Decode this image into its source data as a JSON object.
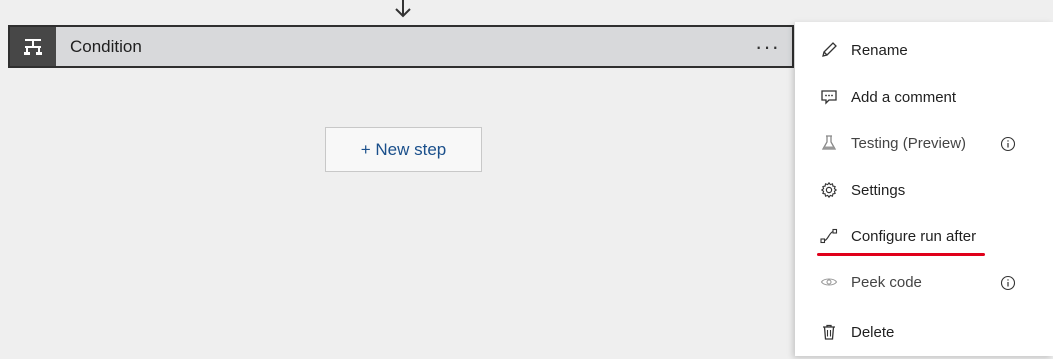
{
  "condition": {
    "title": "Condition",
    "more_label": "···",
    "icon": "condition-icon"
  },
  "canvas": {
    "new_step_label": "+ New step"
  },
  "menu": {
    "items": [
      {
        "label": "Rename",
        "icon": "pencil-icon",
        "enabled": true
      },
      {
        "label": "Add a comment",
        "icon": "comment-icon",
        "enabled": true
      },
      {
        "label": "Testing (Preview)",
        "icon": "flask-icon",
        "enabled": false,
        "info": true
      },
      {
        "label": "Settings",
        "icon": "gear-icon",
        "enabled": true
      },
      {
        "label": "Configure run after",
        "icon": "run-after-icon",
        "enabled": true,
        "highlighted": true
      },
      {
        "label": "Peek code",
        "icon": "eye-icon",
        "enabled": false,
        "info": true
      },
      {
        "label": "Delete",
        "icon": "trash-icon",
        "enabled": true
      }
    ]
  },
  "colors": {
    "highlight_underline": "#e0001a",
    "link_text": "#1a4f8b",
    "card_border": "#2f2f2f"
  }
}
